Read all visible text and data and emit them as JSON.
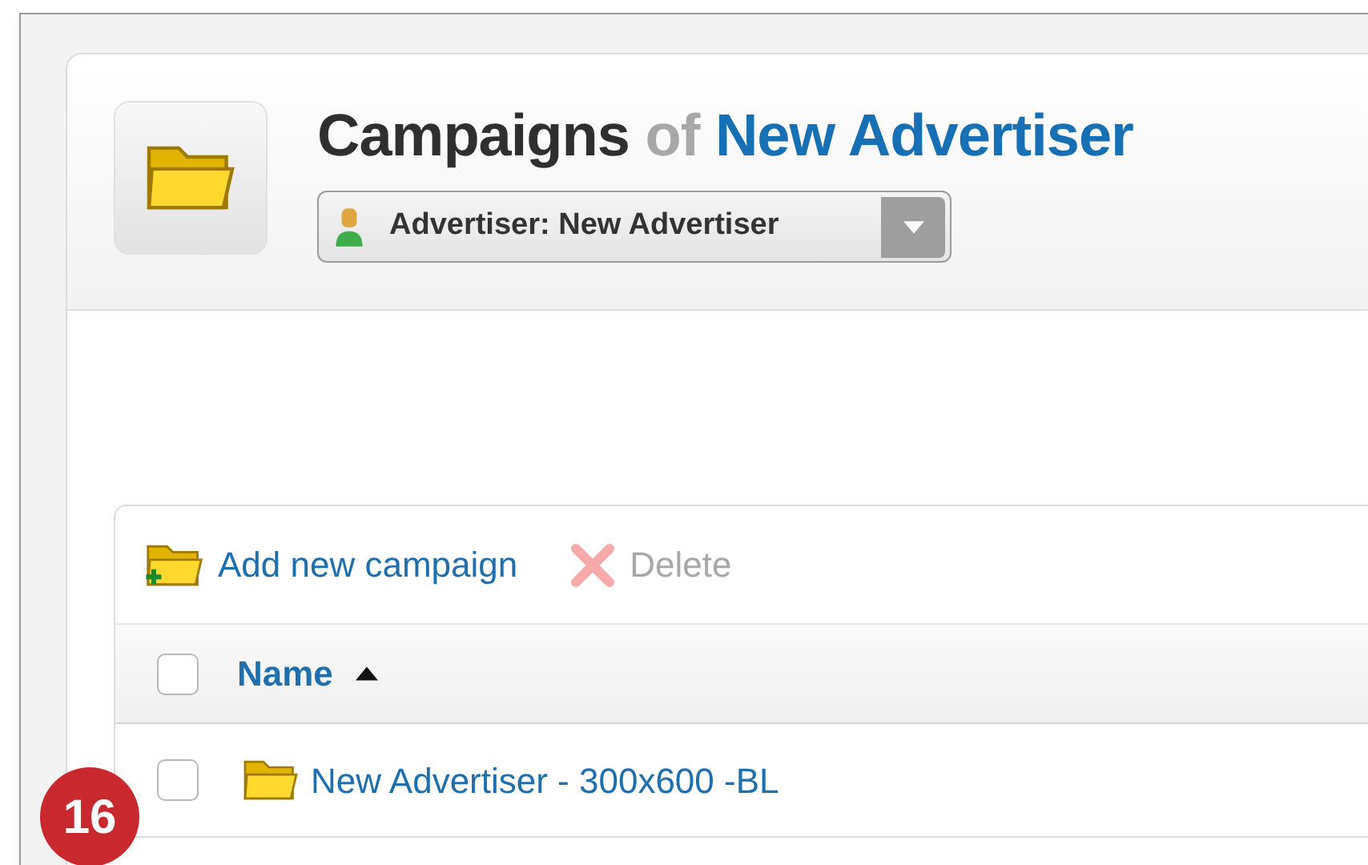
{
  "header": {
    "title": "Campaigns",
    "title_joiner": "of",
    "title_owner": "New Advertiser",
    "advertiser_select": {
      "value": "Advertiser: New Advertiser"
    }
  },
  "toolbar": [
    {
      "kind": "add",
      "label": "Add new campaign",
      "disabled": false
    },
    {
      "kind": "delete",
      "label": "Delete",
      "disabled": true
    }
  ],
  "table": {
    "select_all": {
      "checked": false
    },
    "columns": [
      {
        "label": "Name",
        "sort_ascending": true
      }
    ],
    "rows": [
      {
        "checked": false,
        "name": "New Advertiser - 300x600 -BL"
      }
    ]
  },
  "step_badge": "16"
}
